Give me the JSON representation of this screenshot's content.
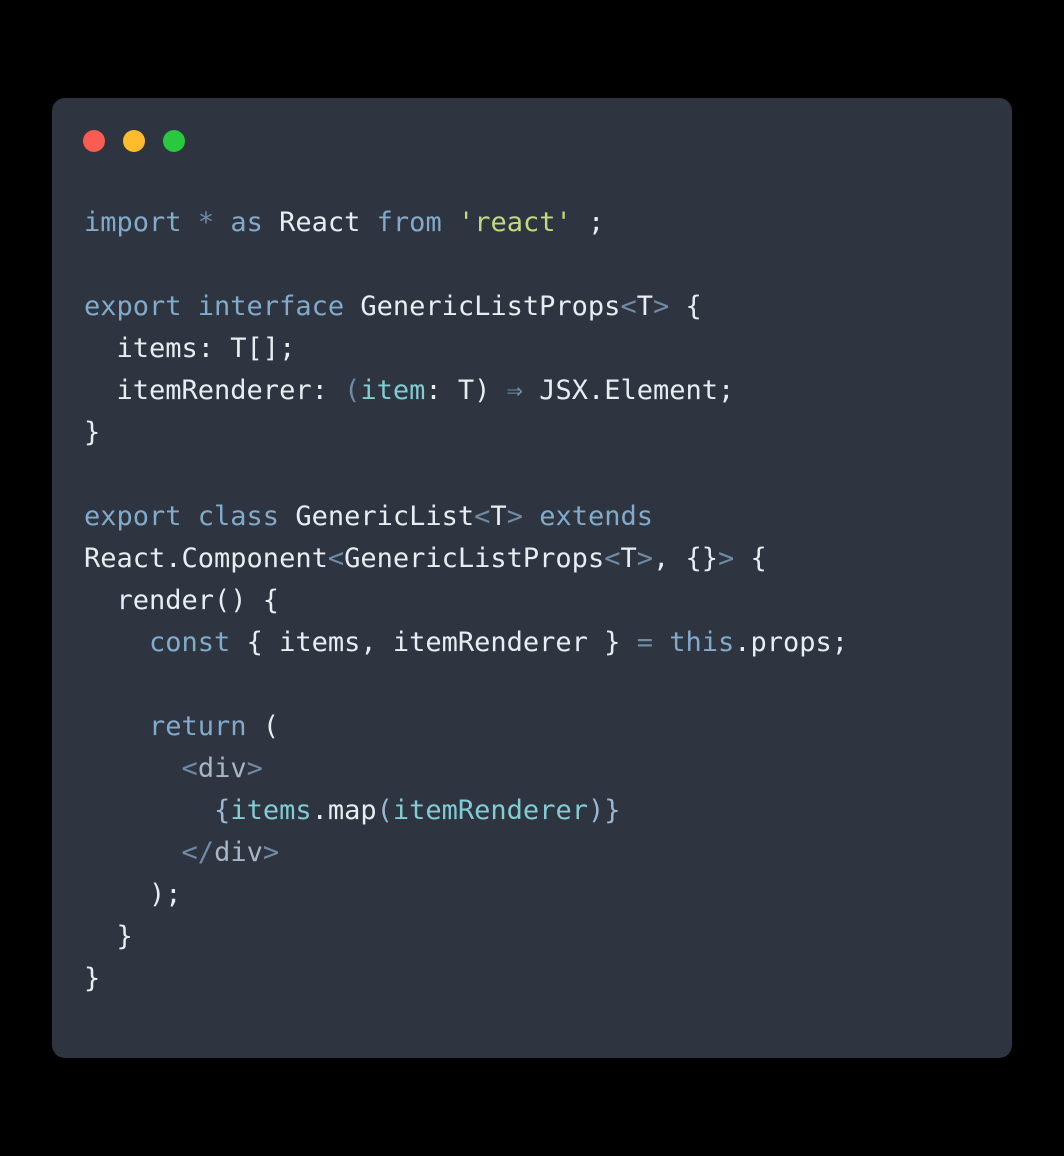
{
  "window": {
    "background_color": "#000000",
    "card_color": "#2e3440",
    "controls": [
      {
        "name": "close",
        "color": "#fb5c52"
      },
      {
        "name": "minimize",
        "color": "#fdbc2c"
      },
      {
        "name": "maximize",
        "color": "#29c83e"
      }
    ]
  },
  "theme": {
    "plain": "#e8edf2",
    "keyword": "#82aaca",
    "string": "#c3d881",
    "operator": "#6f8ba6",
    "param": "#82ccd4",
    "brace": "#9bb7d4",
    "tagname": "#a7b5c4",
    "tagpunct": "#6f8ba6"
  },
  "code": {
    "language": "tsx",
    "plain_text": "import * as React from 'react' ;\n\nexport interface GenericListProps<T> {\n  items: T[];\n  itemRenderer: (item: T) ⇒ JSX.Element;\n}\n\nexport class GenericList<T> extends\nReact.Component<GenericListProps<T>, {}> {\n  render() {\n    const { items, itemRenderer } = this.props;\n\n    return (\n      <div>\n        {items.map(itemRenderer)}\n      </div>\n    );\n  }\n}",
    "lines": [
      {
        "id": "l1",
        "tokens": [
          {
            "t": "import",
            "c": "keyword"
          },
          {
            "t": " ",
            "c": "plain"
          },
          {
            "t": "*",
            "c": "operator"
          },
          {
            "t": " ",
            "c": "plain"
          },
          {
            "t": "as",
            "c": "keyword"
          },
          {
            "t": " ",
            "c": "plain"
          },
          {
            "t": "React",
            "c": "plain"
          },
          {
            "t": " ",
            "c": "plain"
          },
          {
            "t": "from",
            "c": "keyword"
          },
          {
            "t": " ",
            "c": "plain"
          },
          {
            "t": "'react'",
            "c": "string"
          },
          {
            "t": " ;",
            "c": "plain"
          }
        ]
      },
      {
        "id": "l2",
        "tokens": []
      },
      {
        "id": "l3",
        "tokens": [
          {
            "t": "export interface",
            "c": "keyword"
          },
          {
            "t": " GenericListProps",
            "c": "plain"
          },
          {
            "t": "<",
            "c": "operator"
          },
          {
            "t": "T",
            "c": "plain"
          },
          {
            "t": ">",
            "c": "operator"
          },
          {
            "t": " {",
            "c": "plain"
          }
        ]
      },
      {
        "id": "l4",
        "tokens": [
          {
            "t": "  items: T[];",
            "c": "plain"
          }
        ]
      },
      {
        "id": "l5",
        "tokens": [
          {
            "t": "  itemRenderer: ",
            "c": "plain"
          },
          {
            "t": "(",
            "c": "operator"
          },
          {
            "t": "item",
            "c": "param"
          },
          {
            "t": ": T)",
            "c": "plain"
          },
          {
            "t": " ⇒ ",
            "c": "operator"
          },
          {
            "t": "JSX.Element;",
            "c": "plain"
          }
        ]
      },
      {
        "id": "l6",
        "tokens": [
          {
            "t": "}",
            "c": "plain"
          }
        ]
      },
      {
        "id": "l7",
        "tokens": []
      },
      {
        "id": "l8",
        "tokens": [
          {
            "t": "export class",
            "c": "keyword"
          },
          {
            "t": " GenericList",
            "c": "plain"
          },
          {
            "t": "<",
            "c": "operator"
          },
          {
            "t": "T",
            "c": "plain"
          },
          {
            "t": ">",
            "c": "operator"
          },
          {
            "t": " ",
            "c": "plain"
          },
          {
            "t": "extends",
            "c": "keyword"
          }
        ]
      },
      {
        "id": "l9",
        "tokens": [
          {
            "t": "React.Component",
            "c": "plain"
          },
          {
            "t": "<",
            "c": "operator"
          },
          {
            "t": "GenericListProps",
            "c": "plain"
          },
          {
            "t": "<",
            "c": "operator"
          },
          {
            "t": "T",
            "c": "plain"
          },
          {
            "t": ">",
            "c": "operator"
          },
          {
            "t": ", {}",
            "c": "plain"
          },
          {
            "t": ">",
            "c": "operator"
          },
          {
            "t": " {",
            "c": "plain"
          }
        ]
      },
      {
        "id": "l10",
        "tokens": [
          {
            "t": "  render() {",
            "c": "plain"
          }
        ]
      },
      {
        "id": "l11",
        "tokens": [
          {
            "t": "    ",
            "c": "plain"
          },
          {
            "t": "const",
            "c": "keyword"
          },
          {
            "t": " { items, itemRenderer } ",
            "c": "plain"
          },
          {
            "t": "=",
            "c": "operator"
          },
          {
            "t": " ",
            "c": "plain"
          },
          {
            "t": "this",
            "c": "keyword"
          },
          {
            "t": ".props;",
            "c": "plain"
          }
        ]
      },
      {
        "id": "l12",
        "tokens": []
      },
      {
        "id": "l13",
        "tokens": [
          {
            "t": "    ",
            "c": "plain"
          },
          {
            "t": "return",
            "c": "keyword"
          },
          {
            "t": " (",
            "c": "plain"
          }
        ]
      },
      {
        "id": "l14",
        "tokens": [
          {
            "t": "      ",
            "c": "plain"
          },
          {
            "t": "<",
            "c": "tagpunct"
          },
          {
            "t": "div",
            "c": "tagname"
          },
          {
            "t": ">",
            "c": "tagpunct"
          }
        ]
      },
      {
        "id": "l15",
        "tokens": [
          {
            "t": "        ",
            "c": "plain"
          },
          {
            "t": "{",
            "c": "brace"
          },
          {
            "t": "items",
            "c": "param"
          },
          {
            "t": ".map",
            "c": "plain"
          },
          {
            "t": "(",
            "c": "brace"
          },
          {
            "t": "itemRenderer",
            "c": "param"
          },
          {
            "t": ")",
            "c": "brace"
          },
          {
            "t": "}",
            "c": "brace"
          }
        ]
      },
      {
        "id": "l16",
        "tokens": [
          {
            "t": "      ",
            "c": "plain"
          },
          {
            "t": "</",
            "c": "tagpunct"
          },
          {
            "t": "div",
            "c": "tagname"
          },
          {
            "t": ">",
            "c": "tagpunct"
          }
        ]
      },
      {
        "id": "l17",
        "tokens": [
          {
            "t": "    );",
            "c": "plain"
          }
        ]
      },
      {
        "id": "l18",
        "tokens": [
          {
            "t": "  }",
            "c": "plain"
          }
        ]
      },
      {
        "id": "l19",
        "tokens": [
          {
            "t": "}",
            "c": "plain"
          }
        ]
      }
    ]
  }
}
